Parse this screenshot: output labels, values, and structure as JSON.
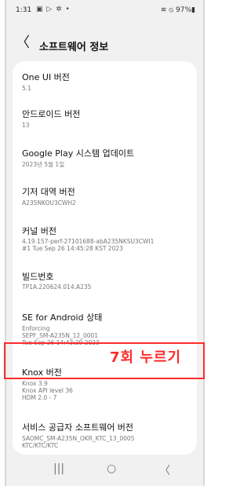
{
  "status": {
    "time": "1:31",
    "icons": "▣ ▷ ✲ •",
    "right": "≋ ⦸ 97%▮"
  },
  "header": {
    "back": "〈",
    "title": "소프트웨어 정보"
  },
  "items": [
    {
      "label": "One UI 버전",
      "value": "5.1"
    },
    {
      "label": "안드로이드 버전",
      "value": "13"
    },
    {
      "label": "Google Play 시스템 업데이트",
      "value": "2023년 5월 1일"
    },
    {
      "label": "기저 대역 버전",
      "value": "A235NKOU3CWH2"
    },
    {
      "label": "커널 버전",
      "value": "4.19.157-perf-27101688-abA235NKSU3CWI1\n#1 Tue Sep 26 14:45:28 KST 2023"
    },
    {
      "label": "빌드번호",
      "value": "TP1A.220624.014.A235"
    },
    {
      "label": "SE for Android 상태",
      "value": "Enforcing\nSEPF_SM-A235N_12_0001\nTue Sep 26 14:43:29 2023"
    },
    {
      "label": "Knox 버전",
      "value": "Knox 3.9\nKnox API level 36\nHDM 2.0 - 7"
    },
    {
      "label": "서비스 공급자 소프트웨어 버전",
      "value": "SAOMC_SM-A235N_OKR_KTC_13_0005\nKTC/KTC/KTC"
    }
  ],
  "annotation": "7회 누르기",
  "nav": {
    "recents": "|||",
    "home": "○",
    "back": "〈"
  }
}
